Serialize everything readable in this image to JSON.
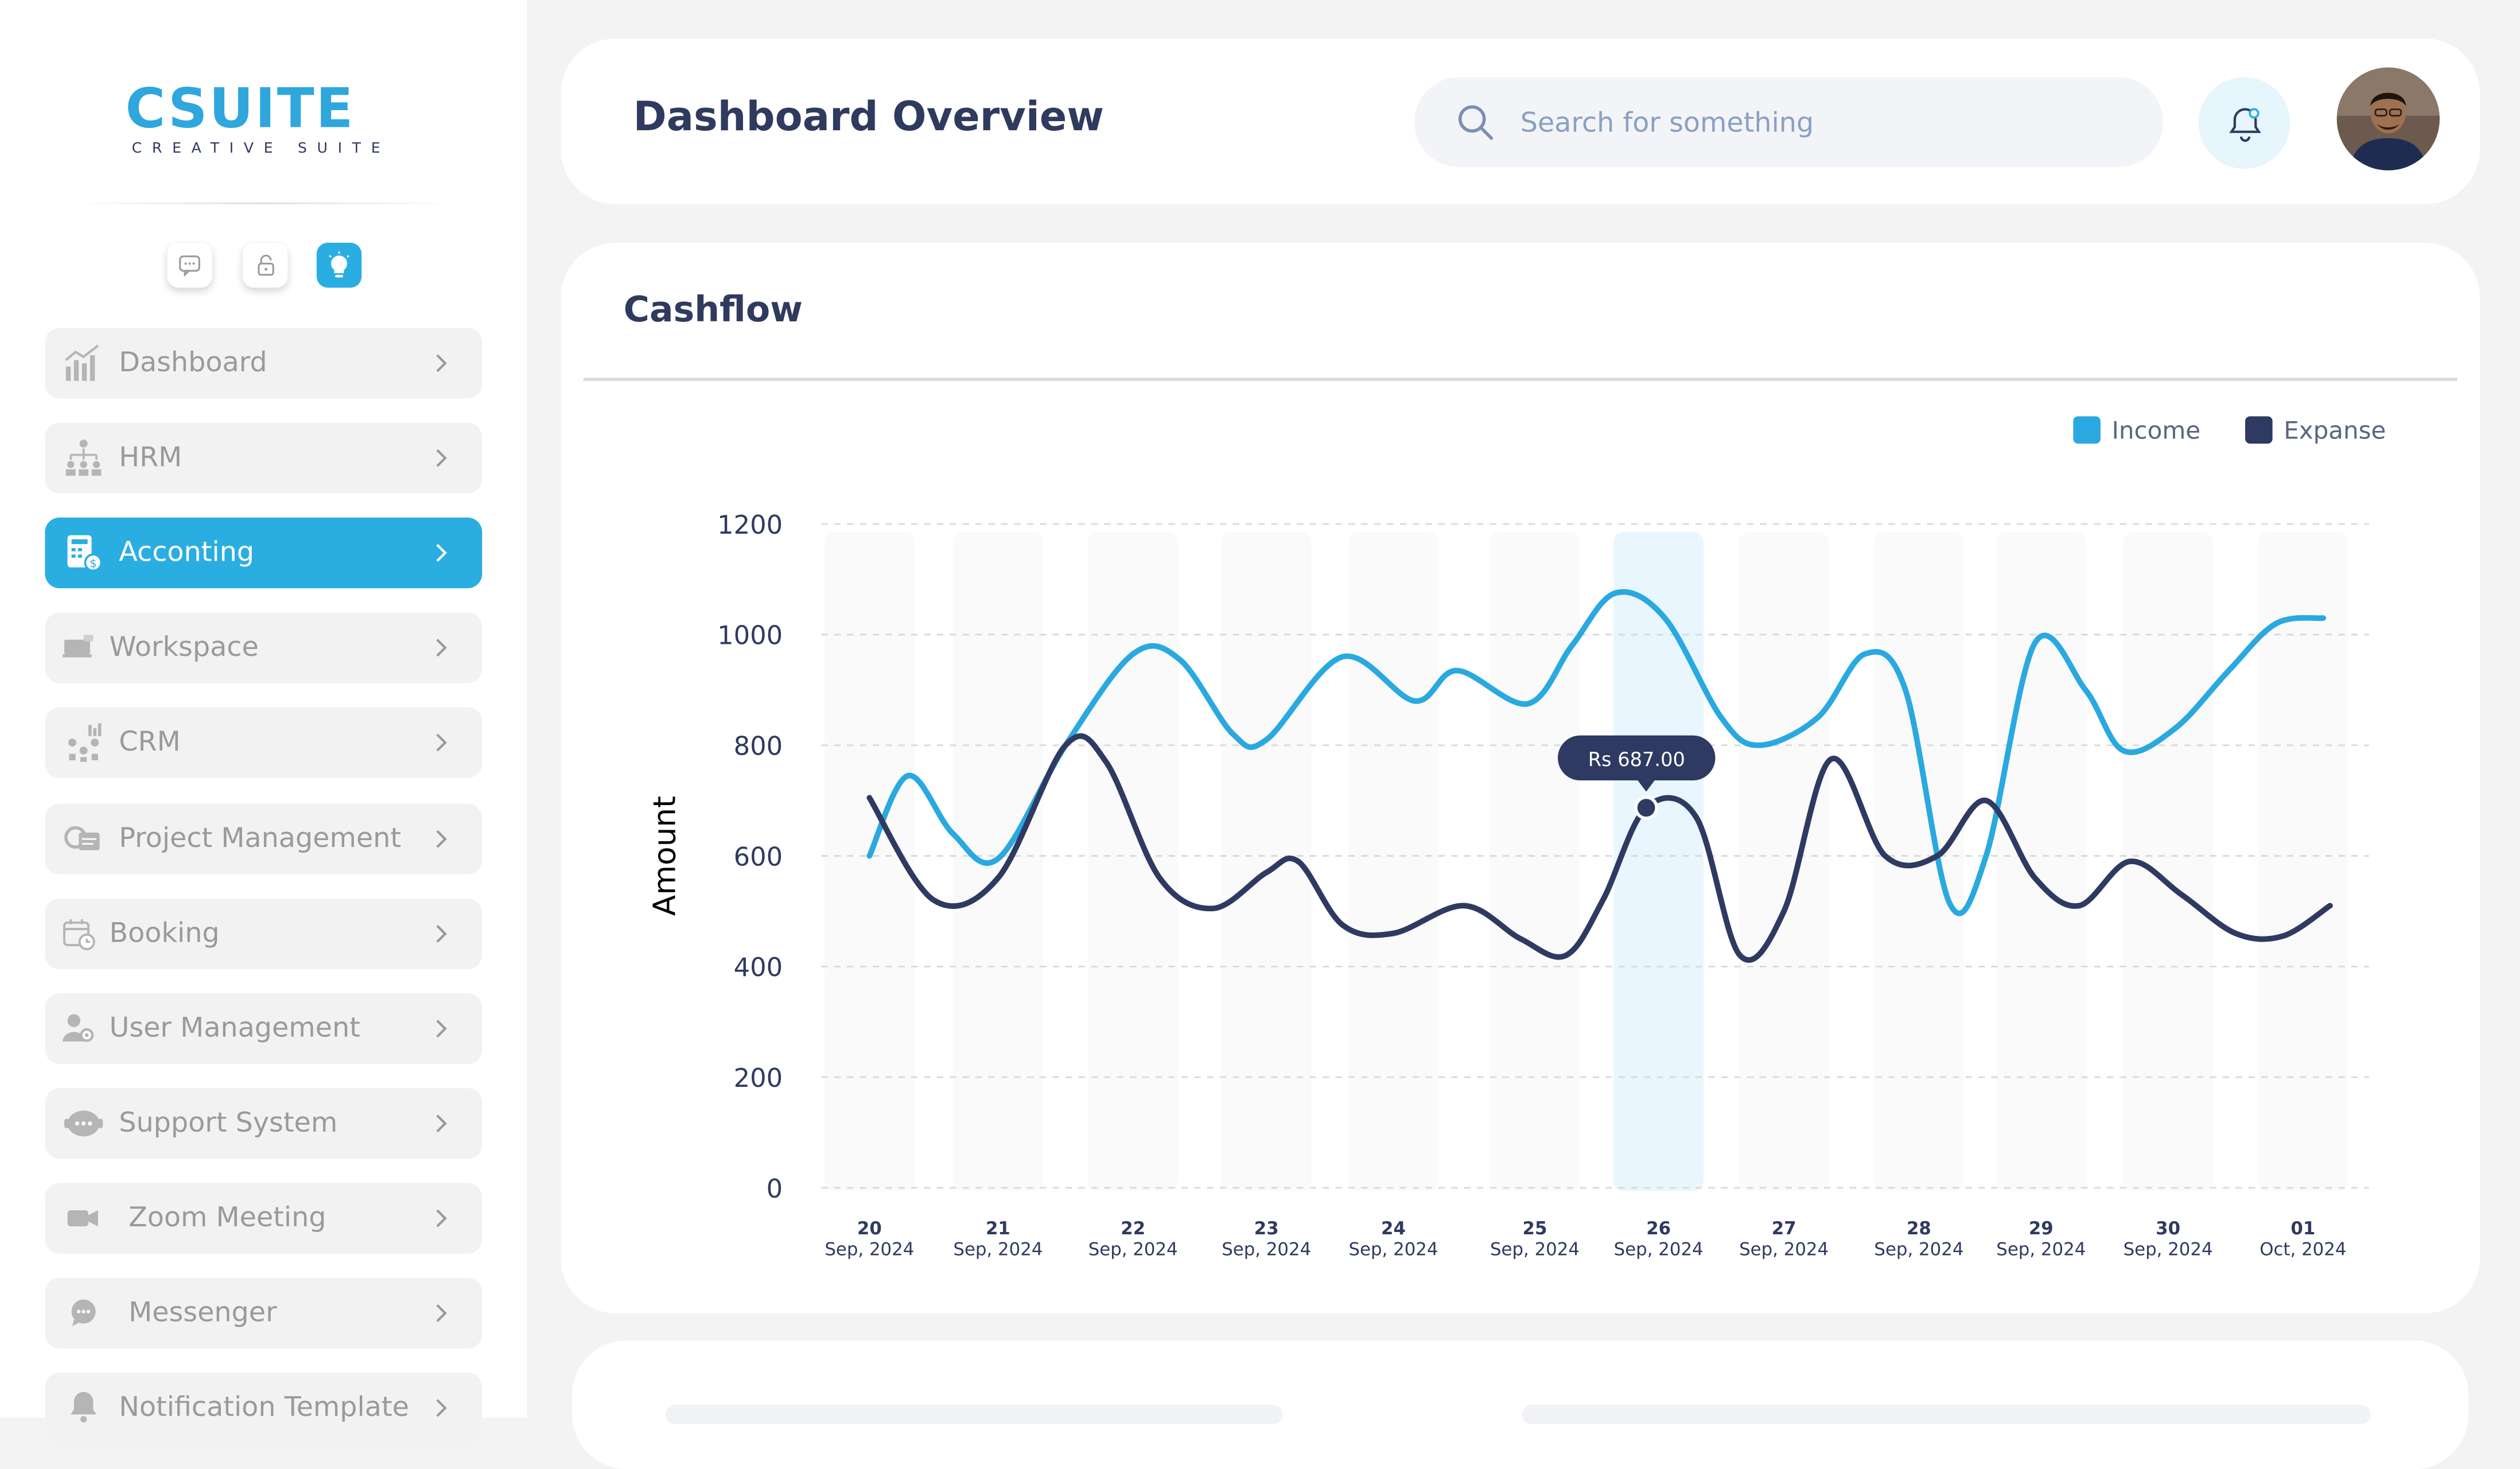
{
  "app": {
    "logo_text": "CSUITE",
    "logo_sub": "CREATIVE SUITE"
  },
  "sidebar": {
    "items": [
      {
        "label": "Dashboard",
        "icon": "bar-chart-icon",
        "active": false
      },
      {
        "label": "HRM",
        "icon": "org-chart-icon",
        "active": false
      },
      {
        "label": "Acconting",
        "icon": "accounting-icon",
        "active": true
      },
      {
        "label": "Workspace",
        "icon": "workspace-icon",
        "active": false
      },
      {
        "label": "CRM",
        "icon": "crm-icon",
        "active": false
      },
      {
        "label": "Project Management",
        "icon": "project-icon",
        "active": false
      },
      {
        "label": "Booking",
        "icon": "calendar-icon",
        "active": false
      },
      {
        "label": "User Management",
        "icon": "user-gear-icon",
        "active": false
      },
      {
        "label": "Support System",
        "icon": "support-icon",
        "active": false
      },
      {
        "label": "Zoom Meeting",
        "icon": "video-icon",
        "active": false
      },
      {
        "label": "Messenger",
        "icon": "chat-icon",
        "active": false
      },
      {
        "label": "Notification Template",
        "icon": "bell-icon",
        "active": false
      }
    ]
  },
  "header": {
    "title": "Dashboard Overview",
    "search_placeholder": "Search for something"
  },
  "colors": {
    "accent": "#2aaee2",
    "income": "#29a9e0",
    "expense": "#2f3a62",
    "title": "#2f3a5f"
  },
  "cashflow": {
    "title": "Cashflow",
    "tooltip": "Rs 687.00"
  },
  "chart_data": {
    "type": "line",
    "title": "Cashflow",
    "xlabel": "",
    "ylabel": "Amount",
    "ylim": [
      0,
      1200
    ],
    "yticks": [
      0,
      200,
      400,
      600,
      800,
      1000,
      1200
    ],
    "grid": true,
    "legend_position": "top-right",
    "categories": [
      {
        "day": "20",
        "month": "Sep, 2024"
      },
      {
        "day": "21",
        "month": "Sep, 2024"
      },
      {
        "day": "22",
        "month": "Sep, 2024"
      },
      {
        "day": "23",
        "month": "Sep, 2024"
      },
      {
        "day": "24",
        "month": "Sep, 2024"
      },
      {
        "day": "25",
        "month": "Sep, 2024"
      },
      {
        "day": "26",
        "month": "Sep, 2024"
      },
      {
        "day": "27",
        "month": "Sep, 2024"
      },
      {
        "day": "28",
        "month": "Sep, 2024"
      },
      {
        "day": "29",
        "month": "Sep, 2024"
      },
      {
        "day": "30",
        "month": "Sep, 2024"
      },
      {
        "day": "01",
        "month": "Oct, 2024"
      }
    ],
    "highlight_index": 6,
    "series": [
      {
        "name": "Income",
        "color": "#29a9e0",
        "points": [
          [
            20.0,
            600
          ],
          [
            20.3,
            745
          ],
          [
            20.65,
            640
          ],
          [
            21.0,
            595
          ],
          [
            21.5,
            800
          ],
          [
            22.0,
            965
          ],
          [
            22.35,
            955
          ],
          [
            22.75,
            820
          ],
          [
            23.0,
            810
          ],
          [
            23.6,
            960
          ],
          [
            24.15,
            880
          ],
          [
            24.45,
            935
          ],
          [
            24.95,
            875
          ],
          [
            25.3,
            980
          ],
          [
            25.65,
            1075
          ],
          [
            26.05,
            1030
          ],
          [
            26.5,
            850
          ],
          [
            26.8,
            800
          ],
          [
            27.25,
            850
          ],
          [
            27.6,
            965
          ],
          [
            27.9,
            900
          ],
          [
            28.25,
            515
          ],
          [
            28.55,
            600
          ],
          [
            28.95,
            985
          ],
          [
            29.35,
            900
          ],
          [
            29.65,
            790
          ],
          [
            30.05,
            830
          ],
          [
            30.45,
            935
          ],
          [
            30.8,
            1020
          ],
          [
            31.15,
            1030
          ]
        ]
      },
      {
        "name": "Expanse",
        "color": "#2f3a62",
        "points": [
          [
            20.0,
            705
          ],
          [
            20.5,
            520
          ],
          [
            21.0,
            560
          ],
          [
            21.5,
            800
          ],
          [
            21.8,
            770
          ],
          [
            22.2,
            560
          ],
          [
            22.6,
            505
          ],
          [
            23.0,
            570
          ],
          [
            23.25,
            590
          ],
          [
            23.6,
            475
          ],
          [
            24.0,
            460
          ],
          [
            24.5,
            510
          ],
          [
            24.9,
            450
          ],
          [
            25.25,
            420
          ],
          [
            25.55,
            520
          ],
          [
            25.9,
            687
          ],
          [
            26.3,
            670
          ],
          [
            26.65,
            420
          ],
          [
            27.0,
            500
          ],
          [
            27.35,
            775
          ],
          [
            27.75,
            600
          ],
          [
            28.15,
            600
          ],
          [
            28.55,
            700
          ],
          [
            28.95,
            560
          ],
          [
            29.3,
            510
          ],
          [
            29.7,
            590
          ],
          [
            30.1,
            530
          ],
          [
            30.5,
            460
          ],
          [
            30.85,
            455
          ],
          [
            31.2,
            510
          ]
        ]
      }
    ],
    "tooltip": {
      "label": "Rs 687.00",
      "x": 25.9,
      "y": 687
    }
  }
}
